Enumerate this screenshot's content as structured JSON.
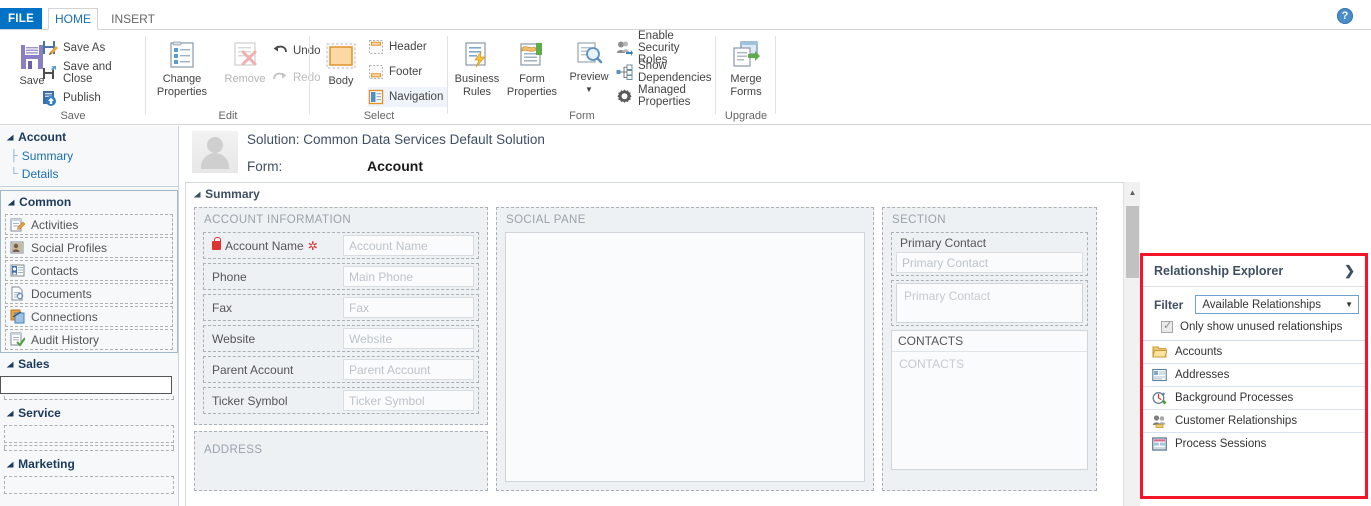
{
  "window": {
    "tabs": [
      {
        "label": "FILE",
        "name": "tab-file"
      },
      {
        "label": "HOME",
        "name": "tab-home"
      },
      {
        "label": "INSERT",
        "name": "tab-insert"
      }
    ],
    "help_label": "?"
  },
  "ribbon": {
    "groups": [
      {
        "label": "Save"
      },
      {
        "label": "Edit"
      },
      {
        "label": "Select"
      },
      {
        "label": "Form"
      },
      {
        "label": "Upgrade"
      }
    ],
    "save_group": {
      "big": {
        "label": "Save",
        "icon": "floppy-disk-icon"
      },
      "items": [
        {
          "label": "Save As",
          "icon": "save-as-icon"
        },
        {
          "label": "Save and Close",
          "icon": "save-and-close-icon"
        },
        {
          "label": "Publish",
          "icon": "publish-icon"
        }
      ]
    },
    "edit_group": {
      "big": [
        {
          "label": "Change Properties",
          "icon": "change-properties-icon",
          "disabled": false
        },
        {
          "label": "Remove",
          "icon": "remove-icon",
          "disabled": true
        }
      ],
      "items": [
        {
          "label": "Undo",
          "icon": "undo-icon",
          "disabled": false
        },
        {
          "label": "Redo",
          "icon": "redo-icon",
          "disabled": true
        }
      ]
    },
    "select_group": {
      "big": {
        "label": "Body",
        "icon": "body-icon"
      },
      "items": [
        {
          "label": "Header",
          "icon": "header-icon"
        },
        {
          "label": "Footer",
          "icon": "footer-icon"
        },
        {
          "label": "Navigation",
          "icon": "navigation-icon"
        }
      ]
    },
    "form_group": {
      "big": [
        {
          "label": "Business Rules",
          "icon": "business-rules-icon"
        },
        {
          "label": "Form Properties",
          "icon": "form-properties-icon"
        },
        {
          "label": "Preview",
          "icon": "preview-icon",
          "split": true
        }
      ],
      "items": [
        {
          "label": "Enable Security Roles",
          "icon": "security-roles-icon"
        },
        {
          "label": "Show Dependencies",
          "icon": "dependencies-icon"
        },
        {
          "label": "Managed Properties",
          "icon": "managed-properties-icon"
        }
      ]
    },
    "upgrade_group": {
      "big": {
        "label": "Merge Forms",
        "icon": "merge-forms-icon"
      }
    }
  },
  "sidebar": {
    "account": {
      "header": "Account",
      "items": [
        {
          "label": "Summary"
        },
        {
          "label": "Details"
        }
      ]
    },
    "common": {
      "header": "Common",
      "items": [
        {
          "label": "Activities",
          "icon": "activities-icon"
        },
        {
          "label": "Social Profiles",
          "icon": "social-profiles-icon"
        },
        {
          "label": "Contacts",
          "icon": "contacts-icon"
        },
        {
          "label": "Documents",
          "icon": "documents-icon"
        },
        {
          "label": "Connections",
          "icon": "connections-icon"
        },
        {
          "label": "Audit History",
          "icon": "audit-history-icon"
        }
      ]
    },
    "sales": {
      "header": "Sales"
    },
    "service": {
      "header": "Service"
    },
    "marketing": {
      "header": "Marketing"
    }
  },
  "form": {
    "solution_line": "Solution: Common Data Services Default Solution",
    "form_label": "Form:",
    "form_name": "Account",
    "tab_name": "Summary",
    "left_section": {
      "title": "ACCOUNT INFORMATION",
      "fields": [
        {
          "label": "Account Name",
          "placeholder": "Account Name",
          "required": true,
          "locked": true
        },
        {
          "label": "Phone",
          "placeholder": "Main Phone",
          "required": false,
          "locked": false
        },
        {
          "label": "Fax",
          "placeholder": "Fax",
          "required": false,
          "locked": false
        },
        {
          "label": "Website",
          "placeholder": "Website",
          "required": false,
          "locked": false
        },
        {
          "label": "Parent Account",
          "placeholder": "Parent Account",
          "required": false,
          "locked": false
        },
        {
          "label": "Ticker Symbol",
          "placeholder": "Ticker Symbol",
          "required": false,
          "locked": false
        }
      ]
    },
    "address_section": {
      "title": "ADDRESS"
    },
    "middle_section": {
      "title": "SOCIAL PANE"
    },
    "right_section": {
      "title": "Section",
      "primary_contact_label": "Primary Contact",
      "primary_contact_placeholder": "Primary Contact",
      "primary_contact_pane_placeholder": "Primary Contact",
      "contacts_title": "CONTACTS",
      "contacts_placeholder": "CONTACTS"
    }
  },
  "relationship_explorer": {
    "title": "Relationship Explorer",
    "chevron": "❯",
    "filter_label": "Filter",
    "filter_value": "Available Relationships",
    "caret": "▼",
    "checkbox_label": "Only show unused relationships",
    "checkbox_checked": true,
    "items": [
      {
        "label": "Accounts",
        "icon": "accounts-folder-icon"
      },
      {
        "label": "Addresses",
        "icon": "addresses-card-icon"
      },
      {
        "label": "Background Processes",
        "icon": "background-processes-icon"
      },
      {
        "label": "Customer Relationships",
        "icon": "customer-relationships-icon"
      },
      {
        "label": "Process Sessions",
        "icon": "process-sessions-icon"
      }
    ]
  },
  "colors": {
    "file_tab_blue": "#0072c6",
    "accent_blue": "#1a6fb5",
    "highlight_red": "#f5152b",
    "required_red": "#d33333",
    "section_bg": "#eef1f4"
  }
}
